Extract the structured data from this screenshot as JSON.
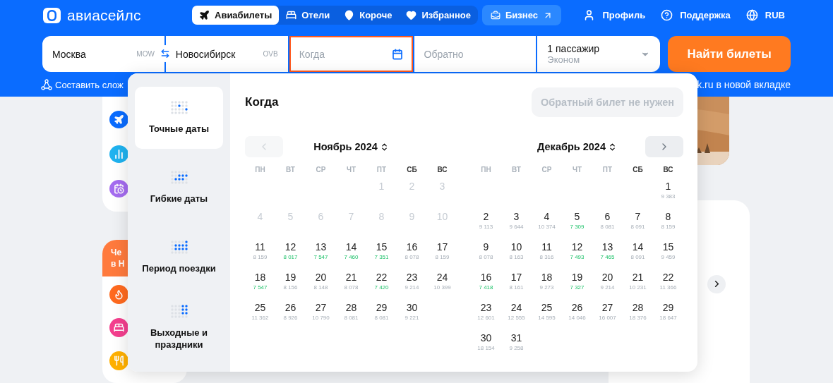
{
  "logo": {
    "text": "авиасейлс"
  },
  "nav_tabs": [
    {
      "label": "Авиабилеты",
      "kind": "flights",
      "selected": true
    },
    {
      "label": "Отели",
      "kind": "hotels",
      "selected": false
    },
    {
      "label": "Короче",
      "kind": "short",
      "selected": false
    },
    {
      "label": "Избранное",
      "kind": "favorites",
      "selected": false
    }
  ],
  "business_link": {
    "label": "Бизнес"
  },
  "user_menu": [
    {
      "label": "Профиль",
      "kind": "profile"
    },
    {
      "label": "Поддержка",
      "kind": "support"
    },
    {
      "label": "RUB",
      "kind": "currency"
    }
  ],
  "search_form": {
    "origin": {
      "value": "Москва",
      "code": "MOW"
    },
    "destination": {
      "value": "Новосибирск",
      "code": "OVB"
    },
    "depart": {
      "placeholder": "Когда",
      "focused": true
    },
    "return": {
      "placeholder": "Обратно",
      "focused": false
    },
    "passengers": {
      "count": "1 пассажир",
      "class": "Эконом"
    },
    "submit": "Найти билеты"
  },
  "links": {
    "complex_route": "Составить слож",
    "new_tab": "k.ru в новой вкладке"
  },
  "promo_card": {
    "lines": [
      "Че",
      "в Н"
    ]
  },
  "date_picker": {
    "title": "Когда",
    "no_return_button": "Обратный билет не нужен",
    "modes": [
      {
        "label": "Точные даты",
        "kind": "exact",
        "selected": true
      },
      {
        "label": "Гибкие даты",
        "kind": "flexible",
        "selected": false
      },
      {
        "label": "Период поездки",
        "kind": "period",
        "selected": false
      },
      {
        "label": "Выходные и праздники",
        "kind": "weekends",
        "selected": false
      }
    ],
    "months": [
      {
        "title": "Ноябрь 2024",
        "prev_button": {
          "disabled": true
        },
        "weekdays": [
          {
            "label": "ПН",
            "weekend": false
          },
          {
            "label": "ВТ",
            "weekend": false
          },
          {
            "label": "СР",
            "weekend": false
          },
          {
            "label": "ЧТ",
            "weekend": false
          },
          {
            "label": "ПТ",
            "weekend": false
          },
          {
            "label": "СБ",
            "weekend": true
          },
          {
            "label": "ВС",
            "weekend": true
          }
        ],
        "weeks": [
          [
            {
              "day": "1",
              "disabled": true
            },
            {
              "day": "2",
              "disabled": true
            },
            {
              "day": "3",
              "disabled": true
            }
          ],
          [
            {
              "day": "4",
              "disabled": true
            },
            {
              "day": "5",
              "disabled": true
            },
            {
              "day": "6",
              "disabled": true
            },
            {
              "day": "7",
              "disabled": true
            },
            {
              "day": "8",
              "disabled": true
            },
            {
              "day": "9",
              "disabled": true
            },
            {
              "day": "10",
              "disabled": true
            }
          ],
          [
            {
              "day": "11",
              "price": "8 159",
              "cheap": false,
              "disabled": false
            },
            {
              "day": "12",
              "price": "8 017",
              "cheap": true,
              "disabled": false
            },
            {
              "day": "13",
              "price": "7 547",
              "cheap": true,
              "disabled": false
            },
            {
              "day": "14",
              "price": "7 460",
              "cheap": true,
              "disabled": false
            },
            {
              "day": "15",
              "price": "7 351",
              "cheap": true,
              "disabled": false
            },
            {
              "day": "16",
              "price": "8 078",
              "cheap": false,
              "disabled": false
            },
            {
              "day": "17",
              "price": "8 159",
              "cheap": false,
              "disabled": false
            }
          ],
          [
            {
              "day": "18",
              "price": "7 547",
              "cheap": true,
              "disabled": false
            },
            {
              "day": "19",
              "price": "8 156",
              "cheap": false,
              "disabled": false
            },
            {
              "day": "20",
              "price": "8 148",
              "cheap": false,
              "disabled": false
            },
            {
              "day": "21",
              "price": "8 078",
              "cheap": false,
              "disabled": false
            },
            {
              "day": "22",
              "price": "7 420",
              "cheap": true,
              "disabled": false
            },
            {
              "day": "23",
              "price": "9 214",
              "cheap": false,
              "disabled": false
            },
            {
              "day": "24",
              "price": "10 399",
              "cheap": false,
              "disabled": false
            }
          ],
          [
            {
              "day": "25",
              "price": "11 362",
              "cheap": false,
              "disabled": false
            },
            {
              "day": "26",
              "price": "8 926",
              "cheap": false,
              "disabled": false
            },
            {
              "day": "27",
              "price": "10 790",
              "cheap": false,
              "disabled": false
            },
            {
              "day": "28",
              "price": "8 081",
              "cheap": false,
              "disabled": false
            },
            {
              "day": "29",
              "price": "8 081",
              "cheap": false,
              "disabled": false
            },
            {
              "day": "30",
              "price": "9 221",
              "cheap": false,
              "disabled": false
            }
          ]
        ]
      },
      {
        "title": "Декабрь 2024",
        "next_button": {
          "disabled": false
        },
        "weekdays": [
          {
            "label": "ПН",
            "weekend": false
          },
          {
            "label": "ВТ",
            "weekend": false
          },
          {
            "label": "СР",
            "weekend": false
          },
          {
            "label": "ЧТ",
            "weekend": false
          },
          {
            "label": "ПТ",
            "weekend": false
          },
          {
            "label": "СБ",
            "weekend": true
          },
          {
            "label": "ВС",
            "weekend": true
          }
        ],
        "weeks": [
          [
            {
              "day": "1",
              "price": "9 383",
              "cheap": false,
              "disabled": false
            }
          ],
          [
            {
              "day": "2",
              "price": "9 113",
              "cheap": false,
              "disabled": false
            },
            {
              "day": "3",
              "price": "9 644",
              "cheap": false,
              "disabled": false
            },
            {
              "day": "4",
              "price": "10 374",
              "cheap": false,
              "disabled": false
            },
            {
              "day": "5",
              "price": "7 309",
              "cheap": true,
              "disabled": false
            },
            {
              "day": "6",
              "price": "8 081",
              "cheap": false,
              "disabled": false
            },
            {
              "day": "7",
              "price": "8 091",
              "cheap": false,
              "disabled": false
            },
            {
              "day": "8",
              "price": "8 159",
              "cheap": false,
              "disabled": false
            }
          ],
          [
            {
              "day": "9",
              "price": "8 078",
              "cheap": false,
              "disabled": false
            },
            {
              "day": "10",
              "price": "8 163",
              "cheap": false,
              "disabled": false
            },
            {
              "day": "11",
              "price": "8 316",
              "cheap": false,
              "disabled": false
            },
            {
              "day": "12",
              "price": "7 493",
              "cheap": true,
              "disabled": false
            },
            {
              "day": "13",
              "price": "7 465",
              "cheap": true,
              "disabled": false
            },
            {
              "day": "14",
              "price": "8 091",
              "cheap": false,
              "disabled": false
            },
            {
              "day": "15",
              "price": "9 459",
              "cheap": false,
              "disabled": false
            }
          ],
          [
            {
              "day": "16",
              "price": "7 418",
              "cheap": true,
              "disabled": false
            },
            {
              "day": "17",
              "price": "8 161",
              "cheap": false,
              "disabled": false
            },
            {
              "day": "18",
              "price": "9 273",
              "cheap": false,
              "disabled": false
            },
            {
              "day": "19",
              "price": "7 327",
              "cheap": true,
              "disabled": false
            },
            {
              "day": "20",
              "price": "9 214",
              "cheap": false,
              "disabled": false
            },
            {
              "day": "21",
              "price": "10 231",
              "cheap": false,
              "disabled": false
            },
            {
              "day": "22",
              "price": "11 366",
              "cheap": false,
              "disabled": false
            }
          ],
          [
            {
              "day": "23",
              "price": "12 601",
              "cheap": false,
              "disabled": false
            },
            {
              "day": "24",
              "price": "12 555",
              "cheap": false,
              "disabled": false
            },
            {
              "day": "25",
              "price": "14 595",
              "cheap": false,
              "disabled": false
            },
            {
              "day": "26",
              "price": "14 046",
              "cheap": false,
              "disabled": false
            },
            {
              "day": "27",
              "price": "16 007",
              "cheap": false,
              "disabled": false
            },
            {
              "day": "28",
              "price": "18 376",
              "cheap": false,
              "disabled": false
            },
            {
              "day": "29",
              "price": "18 647",
              "cheap": false,
              "disabled": false
            }
          ],
          [
            {
              "day": "30",
              "price": "18 154",
              "cheap": false,
              "disabled": false
            },
            {
              "day": "31",
              "price": "9 258",
              "cheap": false,
              "disabled": false
            }
          ]
        ]
      }
    ]
  }
}
